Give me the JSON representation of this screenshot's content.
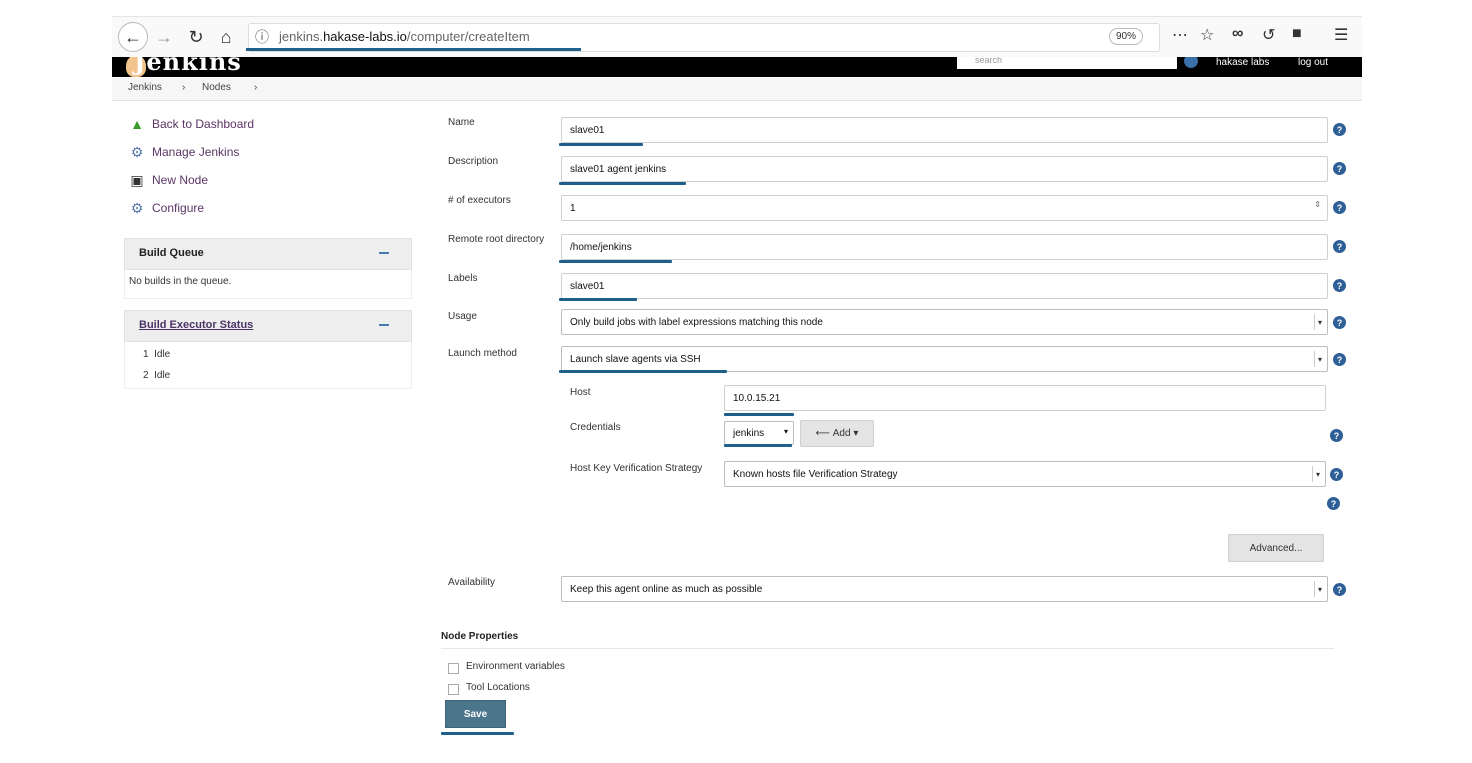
{
  "browser": {
    "url_prefix": "jenkins.",
    "url_host": "hakase-labs.io",
    "url_path": "/computer/createItem",
    "zoom": "90%"
  },
  "jenkins": {
    "logo_text": "Jenkins",
    "search_placeholder": "search",
    "user": "hakase labs",
    "logout": "log out"
  },
  "breadcrumb": [
    "Jenkins",
    "›",
    "Nodes",
    "›"
  ],
  "sidebar": {
    "tasks": [
      {
        "label": "Back to Dashboard"
      },
      {
        "label": "Manage Jenkins"
      },
      {
        "label": "New Node"
      },
      {
        "label": "Configure"
      }
    ],
    "build_queue": {
      "title": "Build Queue",
      "empty": "No builds in the queue."
    },
    "executor_status": {
      "title": "Build Executor Status",
      "executors": [
        {
          "num": "1",
          "state": "Idle"
        },
        {
          "num": "2",
          "state": "Idle"
        }
      ]
    }
  },
  "form": {
    "name": {
      "label": "Name",
      "value": "slave01"
    },
    "description": {
      "label": "Description",
      "value": "slave01 agent jenkins"
    },
    "executors": {
      "label": "# of executors",
      "value": "1"
    },
    "remote_root": {
      "label": "Remote root directory",
      "value": "/home/jenkins"
    },
    "labels": {
      "label": "Labels",
      "value": "slave01"
    },
    "usage": {
      "label": "Usage",
      "value": "Only build jobs with label expressions matching this node"
    },
    "launch_method": {
      "label": "Launch method",
      "value": "Launch slave agents via SSH"
    },
    "host": {
      "label": "Host",
      "value": "10.0.15.21"
    },
    "credentials": {
      "label": "Credentials",
      "value": "jenkins",
      "add_label": "Add"
    },
    "host_key": {
      "label": "Host Key Verification Strategy",
      "value": "Known hosts file Verification Strategy"
    },
    "advanced_label": "Advanced...",
    "availability": {
      "label": "Availability",
      "value": "Keep this agent online as much as possible"
    },
    "node_properties": {
      "title": "Node Properties",
      "options": [
        {
          "label": "Environment variables"
        },
        {
          "label": "Tool Locations"
        }
      ]
    },
    "save_label": "Save"
  },
  "colors": {
    "accent": "#1f5f8b",
    "help": "#2e5f97",
    "save": "#4b758b"
  }
}
